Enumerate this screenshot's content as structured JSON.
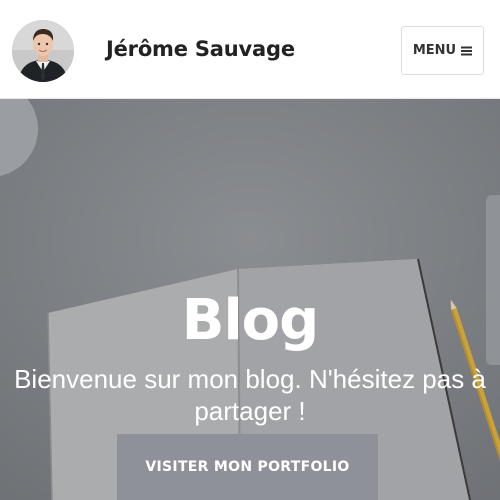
{
  "header": {
    "site_title": "Jérôme Sauvage",
    "menu_label": "MENU",
    "menu_icon": "hamburger-icon"
  },
  "hero": {
    "title": "Blog",
    "subtitle": "Bienvenue sur mon blog. N'hésitez pas à partager !",
    "button_label": "VISITER MON PORTFOLIO"
  },
  "colors": {
    "header_bg": "#ffffff",
    "hero_overlay": "#7b7e82",
    "button_bg": "#8e9198",
    "text_light": "#ffffff",
    "text_dark": "#222222"
  }
}
